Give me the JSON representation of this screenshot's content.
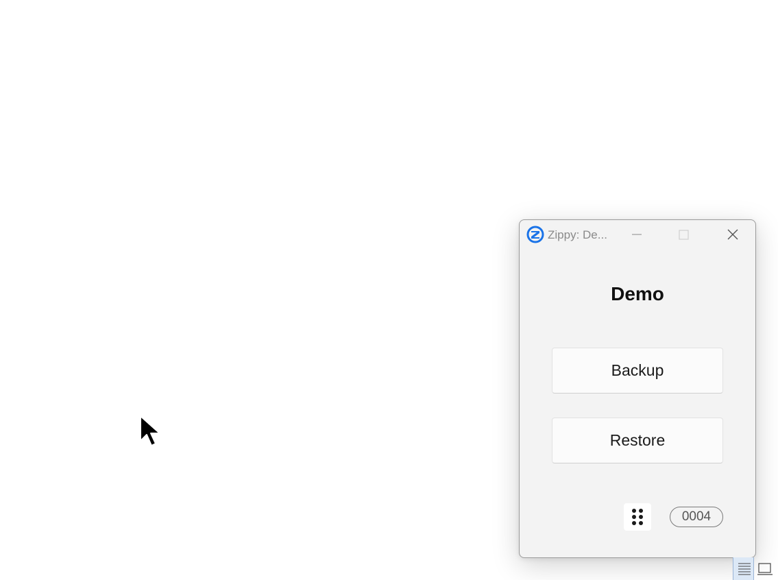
{
  "window": {
    "title": "Zippy: De...",
    "heading": "Demo",
    "buttons": {
      "backup": "Backup",
      "restore": "Restore"
    },
    "counter": "0004",
    "controls": {
      "minimize_icon": "minimize-icon",
      "maximize_icon": "maximize-icon",
      "close_icon": "close-icon"
    },
    "app_icon": "zippy-logo-icon",
    "grip_icon": "drag-handle-icon"
  },
  "colors": {
    "accent": "#1a73e8",
    "window_bg": "#f3f3f3",
    "button_bg": "#fbfbfb"
  },
  "taskbar": {
    "icons": [
      "list-view-icon",
      "monitor-icon"
    ]
  }
}
